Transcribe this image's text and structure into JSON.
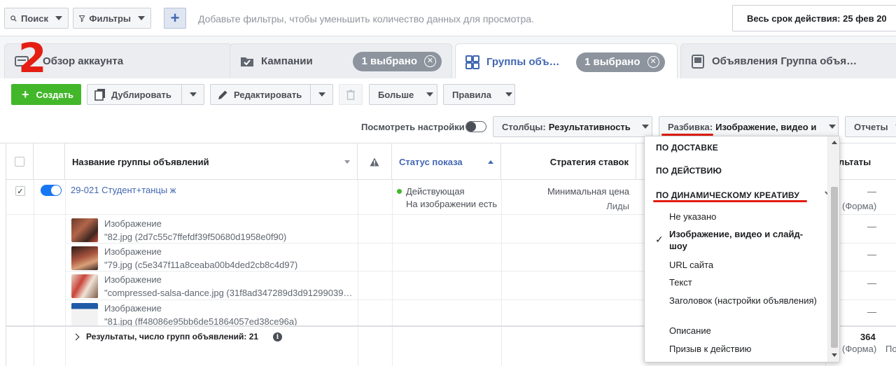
{
  "topbar": {
    "search_label": "Поиск",
    "filters_label": "Фильтры",
    "plus_label": "+",
    "hint": "Добавьте фильтры, чтобы уменьшить количество данных для просмотра.",
    "date_label": "Весь срок действия: 25 фев 20"
  },
  "annotation_number": "2",
  "tabs": [
    {
      "label": "Обзор аккаунта"
    },
    {
      "label": "Кампании",
      "pill": "1 выбрано"
    },
    {
      "label": "Группы объ…",
      "pill": "1 выбрано"
    },
    {
      "label": "Объявления Группа объя…"
    }
  ],
  "toolbar": {
    "create": "Создать",
    "duplicate": "Дублировать",
    "edit": "Редактировать",
    "more": "Больше",
    "rules": "Правила",
    "view_settings": "Посмотреть настройки",
    "columns_label": "Столбцы:",
    "columns_value": "Результативность",
    "breakdown_label": "Разбивка:",
    "breakdown_value": "Изображение, видео и",
    "reports": "Отчеты"
  },
  "table": {
    "headers": {
      "name": "Название группы объявлений",
      "status": "Статус показа",
      "strategy": "Стратегия ставок",
      "results": "ультаты"
    },
    "main_row": {
      "name": "29-021 Студент+танцы ж",
      "status": "Действующая",
      "status_note": "На изображении есть к",
      "strategy": "Минимальная цена",
      "strategy_note": "Лиды",
      "result": "—",
      "result_note": "(Форма)"
    },
    "sub_rows": [
      {
        "type": "Изображение",
        "file": "\"82.jpg (2d7c55c7ffefdf39f50680d1958e0f90)",
        "result": "—"
      },
      {
        "type": "Изображение",
        "file": "\"79.jpg (c5e347f11a8ceaba00b4ded2cb8c4d97)",
        "result": "—"
      },
      {
        "type": "Изображение",
        "file": "\"compressed-salsa-dance.jpg (31f8ad347289d3d91299039…",
        "result": "—"
      },
      {
        "type": "Изображение",
        "file": "\"81.jpg (ff48086e95bb6de51864057ed38ce96a)",
        "result": "—"
      }
    ],
    "summary": {
      "label": "Результаты, число групп объявлений: 21",
      "info_icon": "i",
      "total": "364",
      "total_note": "(Форма)",
      "extra": "По"
    }
  },
  "dropdown": {
    "sections": [
      {
        "label": "ПО ДОСТАВКЕ"
      },
      {
        "label": "ПО ДЕЙСТВИЮ"
      },
      {
        "label": "ПО ДИНАМИЧЕСКОМУ КРЕАТИВУ"
      }
    ],
    "check_mark": "✓",
    "options": [
      "Не указано",
      "Изображение, видео и слайд-шоу",
      "URL сайта",
      "Текст",
      "Заголовок (настройки объявления)",
      "Описание",
      "Призыв к действию"
    ]
  },
  "colors": {
    "accent": "#4267b2",
    "create_green": "#42b72a",
    "annotation_red": "#e41e12",
    "toggle_blue": "#1877f2",
    "status_green": "#42b72a"
  }
}
